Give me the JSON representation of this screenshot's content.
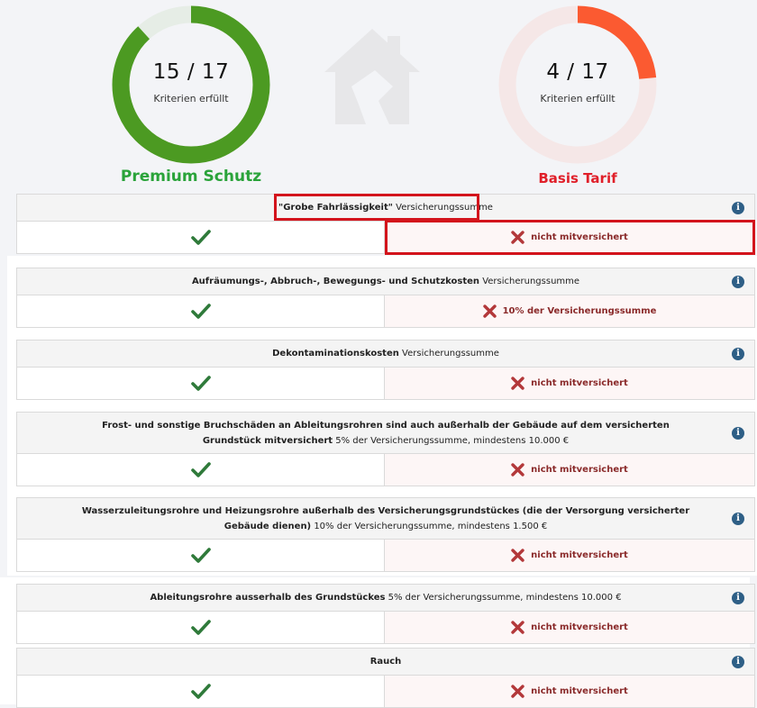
{
  "colors": {
    "premium_green": "#4c9a22",
    "premium_track": "#e6ede6",
    "basis_red": "#fb5a31",
    "basis_track": "#f5e7e7",
    "premium_title": "#2aa33a",
    "basis_title": "#e0202a",
    "check": "#2f7a3a",
    "cross": "#b3383a",
    "highlight": "#d3141c"
  },
  "premium": {
    "fulfilled": 15,
    "total": 17,
    "value_text": "15 / 17",
    "caption": "Kriterien erfüllt",
    "title": "Premium Schutz"
  },
  "basis": {
    "fulfilled": 4,
    "total": 17,
    "value_text": "4 / 17",
    "caption": "Kriterien erfüllt",
    "title": "Basis Tarif"
  },
  "criteria": [
    {
      "bold": "\"Grobe Fahrlässigkeit\"",
      "rest": " Versicherungssumme",
      "basis_text": "nicht mitversichert"
    },
    {
      "bold": "Aufräumungs-, Abbruch-, Bewegungs- und Schutzkosten",
      "rest": " Versicherungssumme",
      "basis_text": "10% der Versicherungssumme"
    },
    {
      "bold": "Dekontaminationskosten",
      "rest": " Versicherungssumme",
      "basis_text": "nicht mitversichert"
    },
    {
      "bold": "Frost- und sonstige Bruchschäden an Ableitungsrohren sind auch außerhalb der Gebäude auf dem versicherten Grundstück mitversichert",
      "rest": " 5% der Versicherungssumme, mindestens 10.000 €",
      "basis_text": "nicht mitversichert"
    },
    {
      "bold": "Wasserzuleitungsrohre und Heizungsrohre außerhalb des Versicherungsgrundstückes (die der Versorgung versicherter Gebäude dienen)",
      "rest": " 10% der Versicherungssumme, mindestens 1.500 €",
      "basis_text": "nicht mitversichert"
    },
    {
      "bold": "Ableitungsrohre ausserhalb des Grundstückes",
      "rest": " 5% der Versicherungssumme, mindestens 10.000 €",
      "basis_text": "nicht mitversichert"
    },
    {
      "bold": "Rauch",
      "rest": "",
      "basis_text": "nicht mitversichert"
    }
  ]
}
